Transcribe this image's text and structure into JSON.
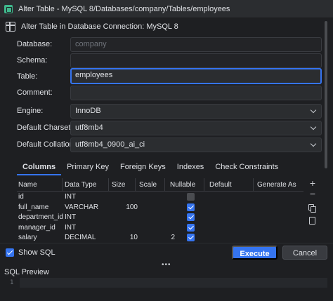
{
  "window": {
    "title": "Alter Table - MySQL 8/Databases/company/Tables/employees"
  },
  "header": {
    "text": "Alter Table in Database Connection: MySQL 8"
  },
  "form": {
    "database_label": "Database:",
    "database_value": "company",
    "schema_label": "Schema:",
    "schema_value": "",
    "table_label": "Table:",
    "table_value": "employees",
    "comment_label": "Comment:",
    "comment_value": "",
    "engine_label": "Engine:",
    "engine_value": "InnoDB",
    "charset_label": "Default Charset:",
    "charset_value": "utf8mb4",
    "collation_label": "Default Collation:",
    "collation_value": "utf8mb4_0900_ai_ci"
  },
  "tabs": [
    "Columns",
    "Primary Key",
    "Foreign Keys",
    "Indexes",
    "Check Constraints"
  ],
  "grid": {
    "headers": [
      "Name",
      "Data Type",
      "Size",
      "Scale",
      "Nullable",
      "Default",
      "Generate As"
    ],
    "rows": [
      {
        "name": "id",
        "type": "INT",
        "size": "",
        "scale": "",
        "nullable": false
      },
      {
        "name": "full_name",
        "type": "VARCHAR",
        "size": "100",
        "scale": "",
        "nullable": true
      },
      {
        "name": "department_id",
        "type": "INT",
        "size": "",
        "scale": "",
        "nullable": true
      },
      {
        "name": "manager_id",
        "type": "INT",
        "size": "",
        "scale": "",
        "nullable": true
      },
      {
        "name": "salary",
        "type": "DECIMAL",
        "size": "10",
        "scale": "2",
        "nullable": true
      }
    ]
  },
  "side_tools": {
    "add": "+",
    "remove": "−"
  },
  "bottom": {
    "show_sql_label": "Show SQL",
    "show_sql_checked": true,
    "execute_label": "Execute",
    "cancel_label": "Cancel"
  },
  "splitter": {
    "dots": "•••"
  },
  "sql_preview": {
    "title": "SQL Preview",
    "line_number": "1"
  },
  "colors": {
    "accent": "#3574f0",
    "background": "#1e1f22",
    "panel": "#2b2d30"
  }
}
